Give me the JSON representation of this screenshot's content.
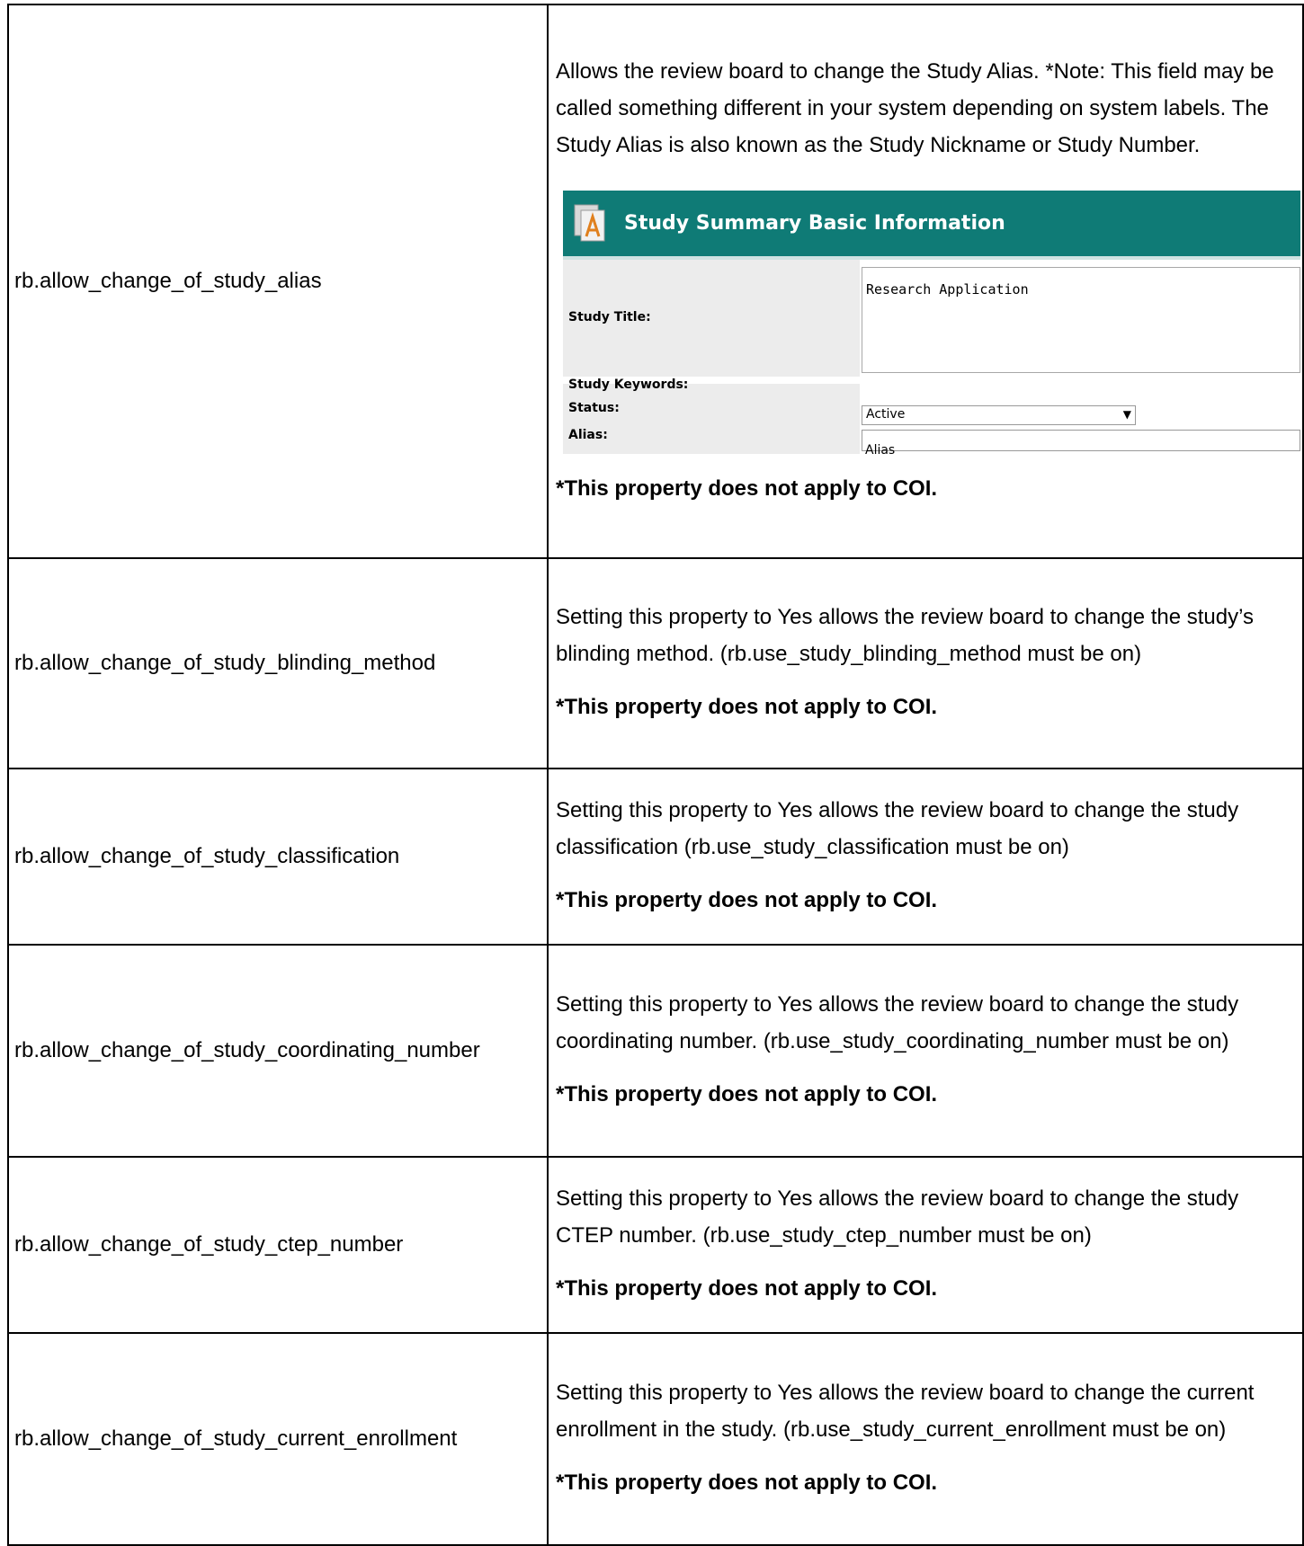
{
  "note_text": "*This property does not apply to COI.",
  "rows": [
    {
      "name": "rb.allow_change_of_study_alias",
      "desc": "Allows the review board to change the Study Alias. *Note: This field may be called something different in your system depending on system labels. The Study Alias is also known as the Study Nickname or Study Number."
    },
    {
      "name": "rb.allow_change_of_study_blinding_method",
      "desc": "Setting this property to Yes allows the review board to change the study’s blinding method.  (rb.use_study_blinding_method must be on)"
    },
    {
      "name": "rb.allow_change_of_study_classification",
      "desc": "Setting this property to Yes allows the review board to change the study classification (rb.use_study_classification must be on)"
    },
    {
      "name": "rb.allow_change_of_study_coordinating_number",
      "desc": "Setting this property to Yes allows the review board to change the study coordinating number.  (rb.use_study_coordinating_number must be on)"
    },
    {
      "name": "rb.allow_change_of_study_ctep_number",
      "desc": "Setting this property to Yes allows the review board to change the study CTEP number.  (rb.use_study_ctep_number must be on)"
    },
    {
      "name": "rb.allow_change_of_study_current_enrollment",
      "desc": "Setting this property to Yes allows the review board to change the current enrollment in the study.  (rb.use_study_current_enrollment must be on)"
    }
  ],
  "screenshot": {
    "header_title": "Study Summary Basic Information",
    "header_color": "#0f7b76",
    "labels": {
      "title": "Study Title:",
      "keywords": "Study Keywords:",
      "status": "Status:",
      "alias": "Alias:"
    },
    "values": {
      "title": "Research Application",
      "status": "Active",
      "alias": "Alias"
    }
  }
}
